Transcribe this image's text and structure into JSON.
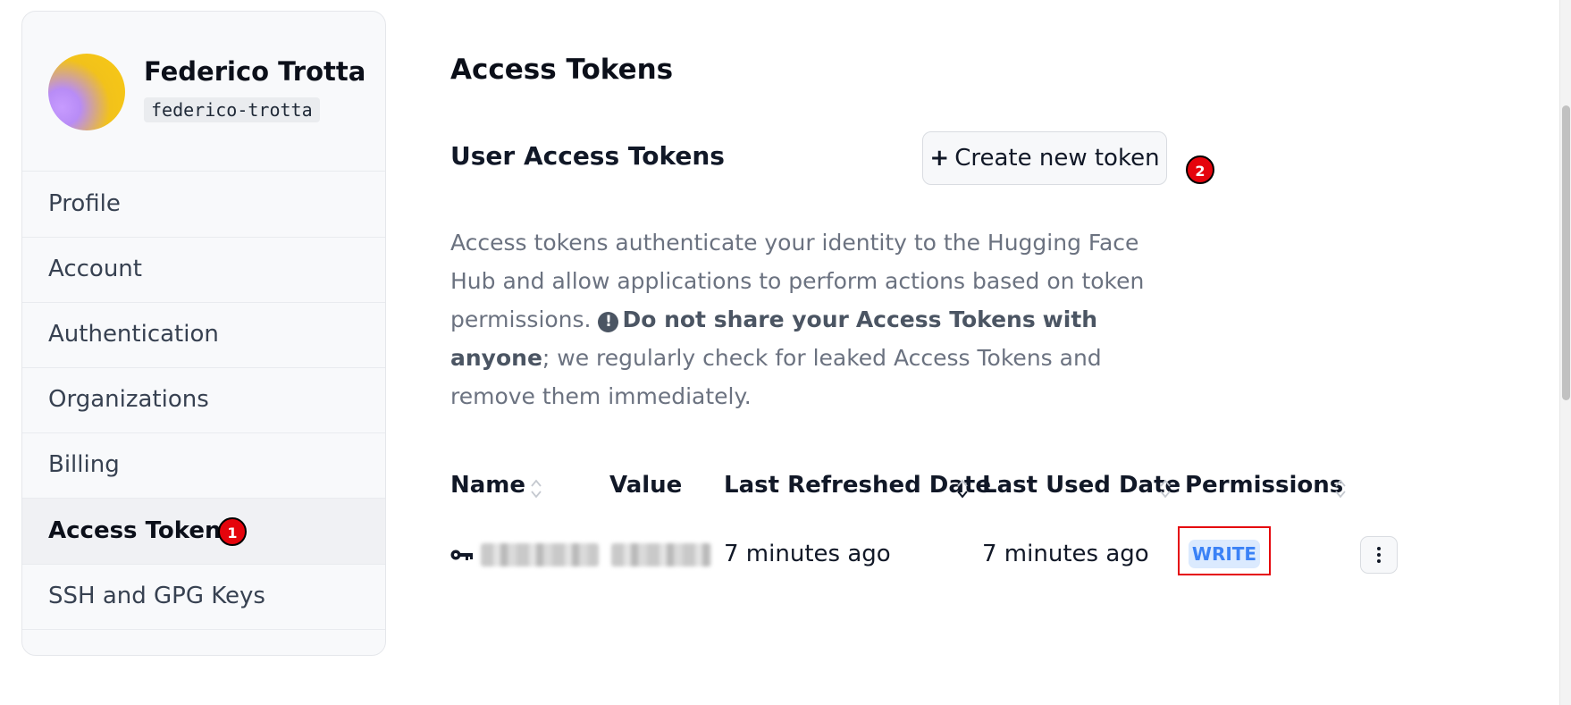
{
  "user": {
    "name": "Federico Trotta",
    "handle": "federico-trotta"
  },
  "sidebar": {
    "items": [
      {
        "label": "Profile"
      },
      {
        "label": "Account"
      },
      {
        "label": "Authentication"
      },
      {
        "label": "Organizations"
      },
      {
        "label": "Billing"
      },
      {
        "label": "Access Tokens",
        "active": true
      },
      {
        "label": "SSH and GPG Keys"
      }
    ]
  },
  "annotations": {
    "step1": "1",
    "step2": "2"
  },
  "main": {
    "page_title": "Access Tokens",
    "section_title": "User Access Tokens",
    "create_button": {
      "icon": "+",
      "label": "Create new token"
    },
    "description": {
      "part1": "Access tokens authenticate your identity to the Hugging Face Hub and allow applications to perform actions based on token permissions.",
      "warning_icon": "!",
      "bold1": "Do not share your",
      "bold2": "Access Tokens",
      "bold3": "with anyone",
      "part2": "; we regularly check for leaked Access Tokens and remove them immediately."
    }
  },
  "table": {
    "columns": [
      {
        "label": "Name",
        "sortable": true
      },
      {
        "label": "Value",
        "sortable": false
      },
      {
        "label": "Last Refreshed Date",
        "sortable": true,
        "sorted": "desc"
      },
      {
        "label": "Last Used Date",
        "sortable": true
      },
      {
        "label": "Permissions",
        "sortable": true
      }
    ],
    "rows": [
      {
        "icon": "key-icon",
        "last_refreshed": "7 minutes ago",
        "last_used": "7 minutes ago",
        "permission": "WRITE"
      }
    ]
  },
  "colors": {
    "annotation_red": "#e5040c",
    "permission_badge_bg": "#dbeafe",
    "permission_badge_text": "#3b82f6"
  }
}
